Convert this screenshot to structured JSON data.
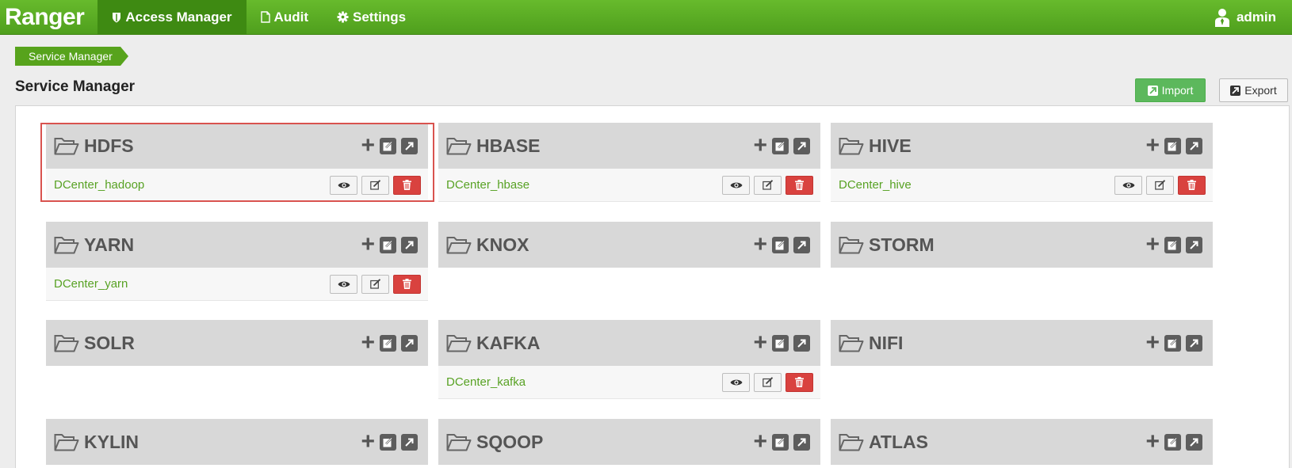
{
  "navbar": {
    "brand": "Ranger",
    "items": [
      {
        "label": "Access Manager",
        "icon": "shield-icon",
        "active": true
      },
      {
        "label": "Audit",
        "icon": "file-icon",
        "active": false
      },
      {
        "label": "Settings",
        "icon": "gear-icon",
        "active": false
      }
    ],
    "user": "admin"
  },
  "breadcrumb": [
    "Service Manager"
  ],
  "page_title": "Service Manager",
  "toolbar": {
    "import_label": "Import",
    "export_label": "Export"
  },
  "colors": {
    "brand_green": "#57a31c",
    "delete_red": "#d9423f",
    "repo_link": "#58a224"
  },
  "services": [
    {
      "name": "HDFS",
      "repos": [
        "DCenter_hadoop"
      ]
    },
    {
      "name": "HBASE",
      "repos": [
        "DCenter_hbase"
      ]
    },
    {
      "name": "HIVE",
      "repos": [
        "DCenter_hive"
      ]
    },
    {
      "name": "YARN",
      "repos": [
        "DCenter_yarn"
      ]
    },
    {
      "name": "KNOX",
      "repos": []
    },
    {
      "name": "STORM",
      "repos": []
    },
    {
      "name": "SOLR",
      "repos": []
    },
    {
      "name": "KAFKA",
      "repos": [
        "DCenter_kafka"
      ]
    },
    {
      "name": "NIFI",
      "repos": []
    },
    {
      "name": "KYLIN",
      "repos": []
    },
    {
      "name": "SQOOP",
      "repos": []
    },
    {
      "name": "ATLAS",
      "repos": []
    }
  ]
}
